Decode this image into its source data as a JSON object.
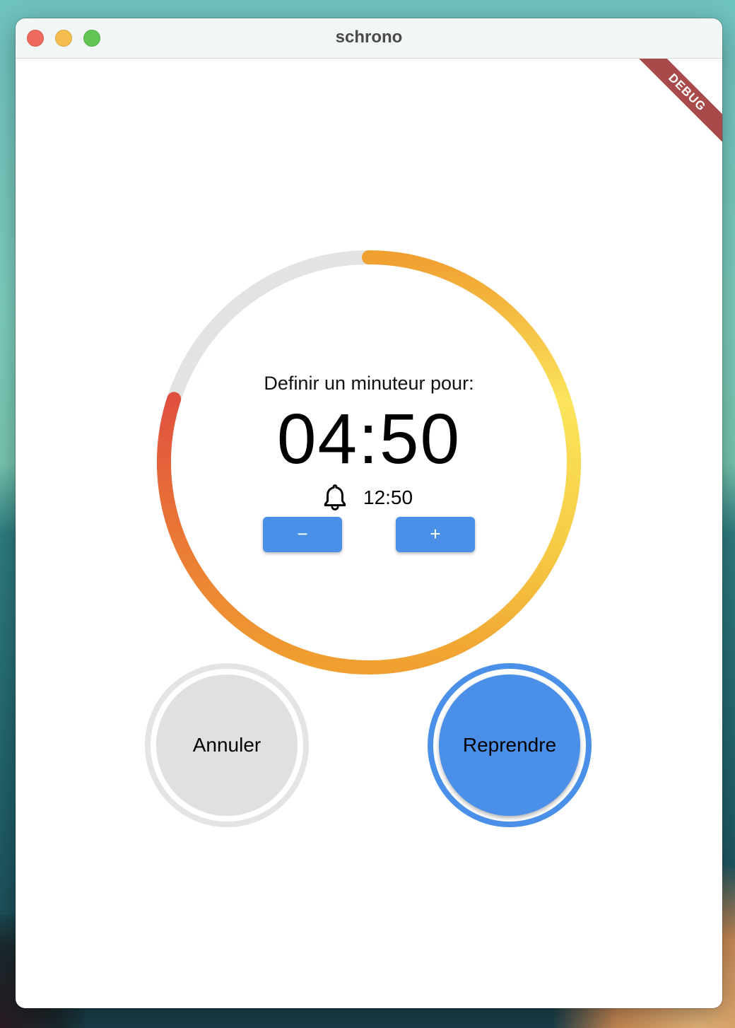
{
  "window": {
    "title": "schrono",
    "debug_banner": "DEBUG"
  },
  "timer": {
    "label": "Definir un minuteur pour:",
    "remaining": "04:50",
    "alarm_time": "12:50",
    "progress_remaining_fraction": 0.8,
    "decrement_label": "−",
    "increment_label": "+"
  },
  "actions": {
    "cancel_label": "Annuler",
    "resume_label": "Reprendre"
  },
  "colors": {
    "accent": "#4a90e8",
    "ring_start": "#e0503f",
    "ring_mid": "#f0a030",
    "ring_end": "#fbe55c",
    "ring_track": "#e3e3e3",
    "cancel_bg": "#e0e0e0",
    "debug_ribbon": "#a94a4a"
  },
  "icons": {
    "alarm": "bell-icon"
  }
}
